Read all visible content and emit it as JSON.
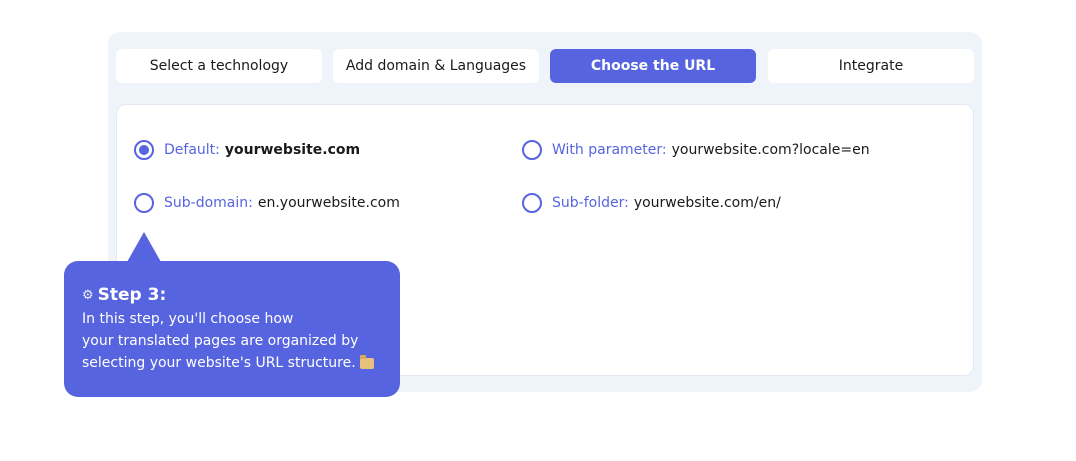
{
  "tabs": [
    {
      "label": "Select a technology",
      "active": false
    },
    {
      "label": "Add domain & Languages",
      "active": false
    },
    {
      "label": "Choose the URL",
      "active": true
    },
    {
      "label": "Integrate",
      "active": false
    }
  ],
  "options": {
    "default": {
      "label": "Default:",
      "value": "yourwebsite.com",
      "checked": true
    },
    "parameter": {
      "label": "With parameter:",
      "value": "yourwebsite.com?locale=en",
      "checked": false
    },
    "subdomain": {
      "label": "Sub-domain:",
      "value": "en.yourwebsite.com",
      "checked": false
    },
    "subfolder": {
      "label": "Sub-folder:",
      "value": "yourwebsite.com/en/",
      "checked": false
    }
  },
  "tooltip": {
    "title": "Step 3:",
    "line1": "In this step, you'll choose how",
    "line2": "your translated pages are organized by",
    "line3": "selecting your website's URL structure.",
    "title_icon": "gear-icon",
    "end_icon": "folder-icon"
  },
  "colors": {
    "accent": "#5664e0",
    "panel_bg": "#eff4fb"
  }
}
